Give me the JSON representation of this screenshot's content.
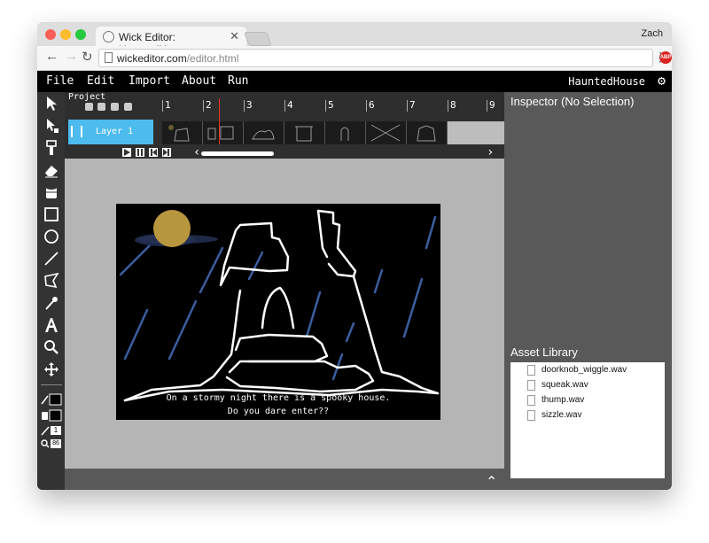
{
  "browser": {
    "tab_title": "Wick Editor: HauntedHouse",
    "user": "Zach",
    "url_host": "wickeditor.com",
    "url_path": "/editor.html",
    "extension_badge": "ABP"
  },
  "menu": {
    "items": [
      "File",
      "Edit",
      "Import",
      "About",
      "Run"
    ],
    "project_name": "HauntedHouse"
  },
  "toolbar": {
    "tools": [
      "cursor-icon",
      "brush-select-icon",
      "paintbrush-icon",
      "eraser-icon",
      "fill-bucket-icon",
      "rectangle-icon",
      "ellipse-icon",
      "line-icon",
      "pen-icon",
      "eyedropper-icon",
      "text-icon",
      "zoom-icon",
      "pan-icon"
    ],
    "line_width": "1",
    "zoom": "86"
  },
  "timeline": {
    "label": "Project",
    "frame_numbers": [
      "1",
      "2",
      "3",
      "4",
      "5",
      "6",
      "7",
      "8",
      "9"
    ],
    "layer_name": "Layer 1"
  },
  "stage": {
    "caption_line1": "On a stormy night there is a spooky house.",
    "caption_line2": "Do you dare enter??"
  },
  "inspector": {
    "title": "Inspector (No Selection)"
  },
  "assets": {
    "title": "Asset Library",
    "files": [
      "doorknob_wiggle.wav",
      "squeak.wav",
      "thump.wav",
      "sizzle.wav"
    ]
  },
  "colors": {
    "timeline_accent": "#4dbbee",
    "playhead": "#ee3333",
    "moon": "#b8963e",
    "rain": "#3a5fa0"
  }
}
